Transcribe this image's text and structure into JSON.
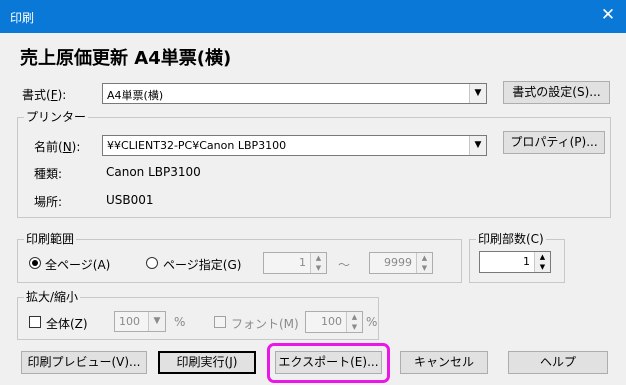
{
  "window": {
    "title": "印刷",
    "close_glyph": "✕"
  },
  "heading": "売上原価更新 A4単票(横)",
  "format": {
    "label": "書式(",
    "mnemonic": "F",
    "label_end": "):",
    "value": "A4単票(横)",
    "settings_button": "書式の設定(S)..."
  },
  "printer": {
    "group_label": "プリンター",
    "name_label": "名前(",
    "name_mnemonic": "N",
    "name_label_end": "):",
    "name_value": "¥¥CLIENT32-PC¥Canon LBP3100",
    "properties_button": "プロパティ(P)...",
    "type_label": "種類:",
    "type_value": "Canon LBP3100",
    "location_label": "場所:",
    "location_value": "USB001"
  },
  "print_range": {
    "group_label": "印刷範囲",
    "all_pages": "全ページ(A)",
    "page_spec": "ページ指定(G)",
    "from": "1",
    "tilde": "～",
    "to": "9999",
    "selected": "all"
  },
  "copies": {
    "group_label": "印刷部数(C)",
    "value": "1"
  },
  "scale": {
    "group_label": "拡大/縮小",
    "all_label": "全体(Z)",
    "all_value": "100",
    "percent": "%",
    "font_label": "フォント(M)",
    "font_value": "100"
  },
  "buttons": {
    "preview": "印刷プレビュー(V)...",
    "print": "印刷実行(J)",
    "export": "エクスポート(E)...",
    "cancel": "キャンセル",
    "help": "ヘルプ"
  },
  "colors": {
    "titlebar": "#0a78d7",
    "highlight": "#ea17e6"
  }
}
